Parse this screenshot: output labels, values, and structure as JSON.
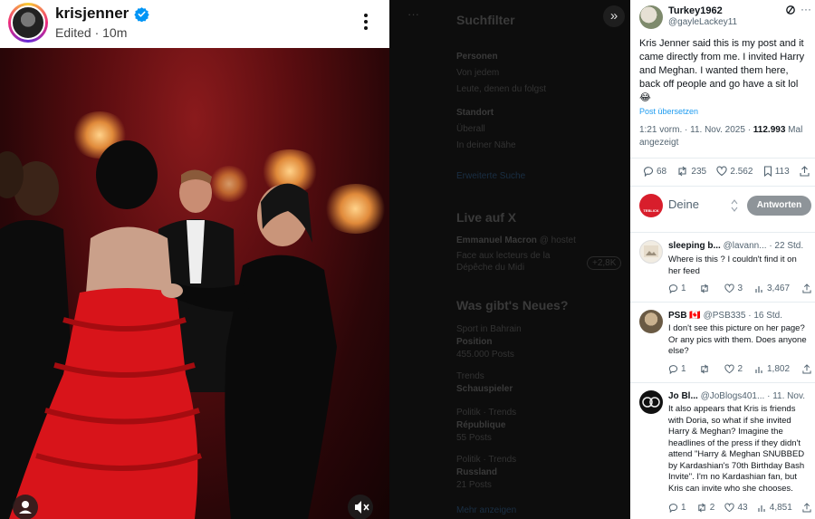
{
  "instagram": {
    "username": "krisjenner",
    "meta": "Edited · 10m"
  },
  "sidebar": {
    "expand_icon": "»",
    "search_filter": "Suchfilter",
    "people": "Personen",
    "from_anyone": "Von jedem",
    "people_you_follow": "Leute, denen du folgst",
    "location": "Standort",
    "anywhere": "Überall",
    "near_you": "In deiner Nähe",
    "advanced_search": "Erweiterte Suche",
    "live": "Live auf X",
    "live_user": "Emmanuel Macron",
    "live_user_handle": "@ hostet",
    "live_text_1": "Face aux lecteurs de la",
    "live_text_2": "Dépêche du Midi",
    "live_count": "+2,8K",
    "whats_new": "Was gibt's Neues?",
    "trend1_cat": "Sport in Bahrain",
    "trend1_name": "Position",
    "trend1_count": "455.000 Posts",
    "trend2_cat": "Trends",
    "trend2_name": "Schauspieler",
    "trend3_cat": "Politik · Trends",
    "trend3_name": "République",
    "trend3_count": "55 Posts",
    "trend4_cat": "Politik · Trends",
    "trend4_name": "Russland",
    "trend4_count": "21 Posts",
    "show_more": "Mehr anzeigen"
  },
  "post": {
    "name": "Turkey1962",
    "handle": "@gayleLackey11",
    "body": "Kris Jenner said this is my post and it came directly from me. I invited Harry and Meghan. I wanted them here, back off people and go have a sit lol 😂",
    "translate": "Post übersetzen",
    "time": "1:21 vorm. · 11. Nov. 2025 · ",
    "views": "112.993",
    "views_label": " Mal angezeigt",
    "replies": "68",
    "reposts": "235",
    "likes": "2.562",
    "bookmarks": "113"
  },
  "reply_box": {
    "placeholder": "Deine",
    "button": "Antworten",
    "avatar_text": "TEBLICK"
  },
  "comments": [
    {
      "name": "sleeping b...",
      "handle": "@lavann...",
      "time": "· 22 Std.",
      "body": "Where is this ? I couldn't find it on her feed",
      "replies": "1",
      "reposts": "",
      "likes": "3",
      "views": "3,467"
    },
    {
      "name": "PSB 🇨🇦",
      "handle": "@PSB335",
      "time": "· 16 Std.",
      "body": "I don't see this picture on her page? Or any pics with them.  Does anyone else?",
      "replies": "1",
      "reposts": "",
      "likes": "2",
      "views": "1,802"
    },
    {
      "name": "Jo Bl...",
      "handle": "@JoBlogs401...",
      "time": "· 11. Nov.",
      "body": "It also appears that Kris is friends with Doria, so what if she invited Harry & Meghan?  Imagine the headlines of the press if they didn't attend \"Harry & Meghan SNUBBED by Kardashian's 70th Birthday Bash Invite\".  I'm no Kardashian fan, but Kris can invite who she chooses.",
      "replies": "1",
      "reposts": "2",
      "likes": "43",
      "views": "4,851"
    }
  ]
}
